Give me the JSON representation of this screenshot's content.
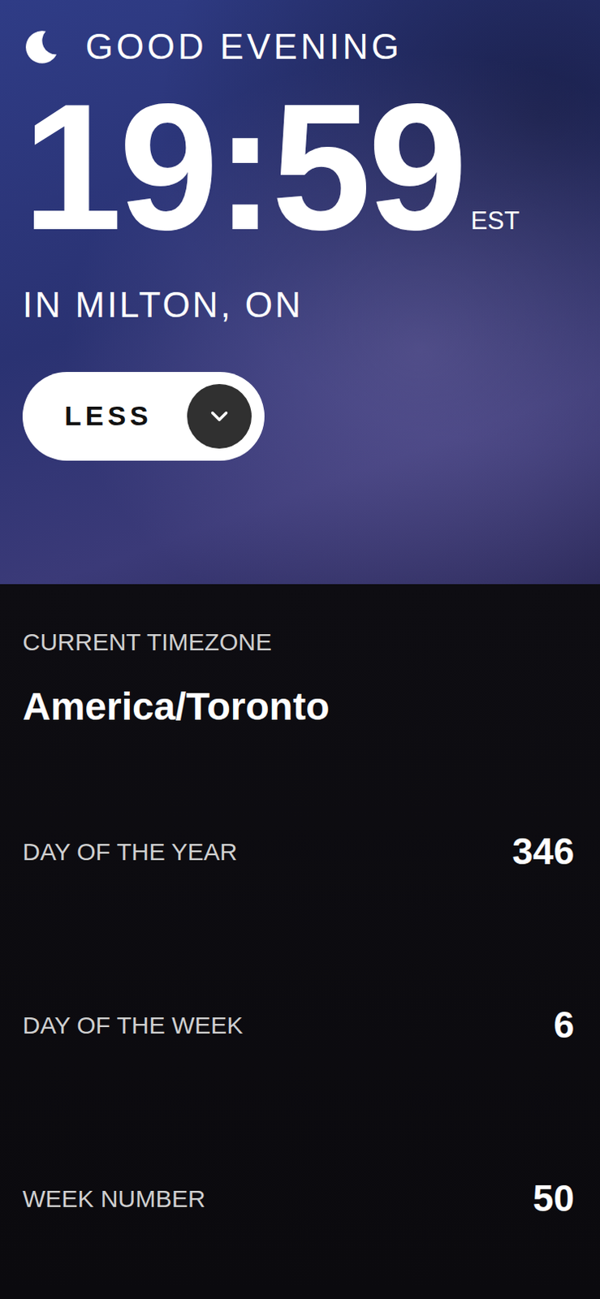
{
  "greeting": "GOOD EVENING",
  "time": "19:59",
  "timezone_abbr": "EST",
  "location": "IN MILTON, ON",
  "toggle": {
    "label": "LESS",
    "expanded": true
  },
  "details": {
    "timezone": {
      "label": "CURRENT TIMEZONE",
      "value": "America/Toronto"
    },
    "rows": [
      {
        "label": "DAY OF THE YEAR",
        "value": "346"
      },
      {
        "label": "DAY OF THE WEEK",
        "value": "6"
      },
      {
        "label": "WEEK NUMBER",
        "value": "50"
      }
    ]
  }
}
